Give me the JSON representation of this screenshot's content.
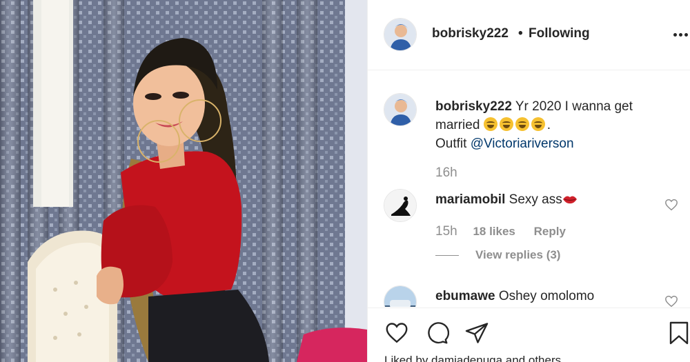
{
  "post": {
    "username": "bobrisky222",
    "separator": "•",
    "follow_status": "Following"
  },
  "caption": {
    "username": "bobrisky222",
    "text_line1": "Yr 2020 I wanna get",
    "text_line2": "married",
    "text_line2_end": ".",
    "emoji_count": 4,
    "outfit_label": "Outfit",
    "mention": "@Victoriariverson",
    "time": "16h"
  },
  "comments": [
    {
      "username": "mariamobil",
      "text": "Sexy ass",
      "time": "15h",
      "likes": "18 likes",
      "reply_label": "Reply",
      "view_replies": "View replies (3)"
    },
    {
      "username": "ebumawe",
      "text": "Oshey omolomo"
    }
  ],
  "footer": {
    "liked_by": "Liked by damiadenuga and others"
  },
  "icons": {
    "like": "heart-icon",
    "comment": "comment-icon",
    "share": "share-icon",
    "save": "bookmark-icon",
    "more": "more-options-icon"
  },
  "colors": {
    "text": "#262626",
    "secondary": "#8e8e8e",
    "mention": "#00376b",
    "border": "#efefef"
  }
}
